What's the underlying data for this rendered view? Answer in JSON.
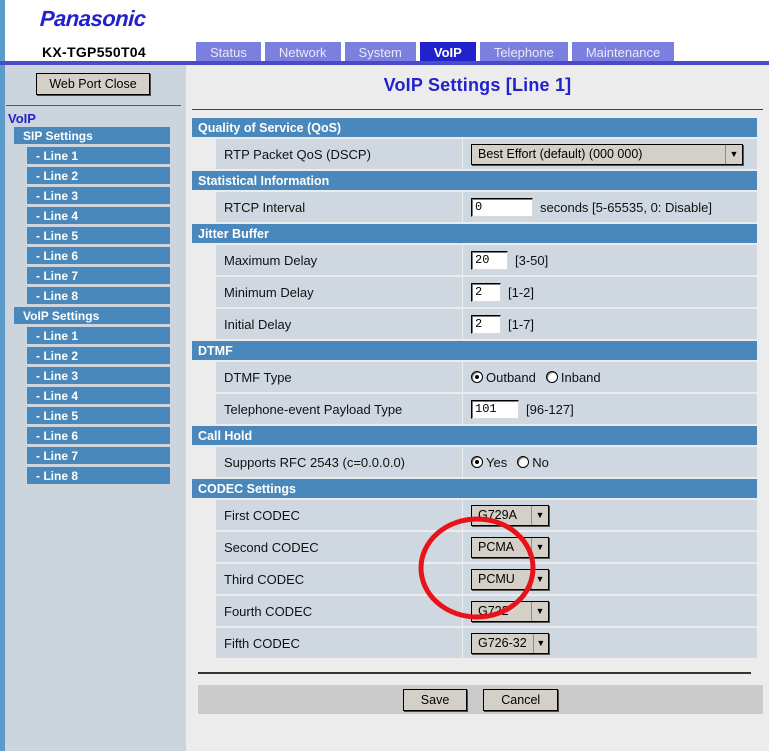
{
  "header": {
    "brand": "Panasonic",
    "model": "KX-TGP550T04"
  },
  "tabs": [
    {
      "label": "Status",
      "active": false
    },
    {
      "label": "Network",
      "active": false
    },
    {
      "label": "System",
      "active": false
    },
    {
      "label": "VoIP",
      "active": true
    },
    {
      "label": "Telephone",
      "active": false
    },
    {
      "label": "Maintenance",
      "active": false
    }
  ],
  "sidebar": {
    "web_port_close": "Web Port Close",
    "title": "VoIP",
    "groups": [
      {
        "label": "SIP Settings",
        "items": [
          "- Line 1",
          "- Line 2",
          "- Line 3",
          "- Line 4",
          "- Line 5",
          "- Line 6",
          "- Line 7",
          "- Line 8"
        ]
      },
      {
        "label": "VoIP Settings",
        "items": [
          "- Line 1",
          "- Line 2",
          "- Line 3",
          "- Line 4",
          "- Line 5",
          "- Line 6",
          "- Line 7",
          "- Line 8"
        ]
      }
    ]
  },
  "main": {
    "page_title": "VoIP Settings [Line 1]",
    "sections": {
      "qos": {
        "header": "Quality of Service (QoS)",
        "rtp_label": "RTP Packet QoS (DSCP)",
        "rtp_value": "Best Effort (default) (000 000)"
      },
      "statistical": {
        "header": "Statistical Information",
        "rtcp_label": "RTCP Interval",
        "rtcp_value": "0",
        "rtcp_hint": "seconds [5-65535, 0: Disable]"
      },
      "jitter": {
        "header": "Jitter Buffer",
        "max_label": "Maximum Delay",
        "max_value": "20",
        "max_hint": "[3-50]",
        "min_label": "Minimum Delay",
        "min_value": "2",
        "min_hint": "[1-2]",
        "init_label": "Initial Delay",
        "init_value": "2",
        "init_hint": "[1-7]"
      },
      "dtmf": {
        "header": "DTMF",
        "type_label": "DTMF Type",
        "type_options": [
          "Outband",
          "Inband"
        ],
        "type_selected": "Outband",
        "payload_label": "Telephone-event Payload Type",
        "payload_value": "101",
        "payload_hint": "[96-127]"
      },
      "callhold": {
        "header": "Call Hold",
        "rfc_label": "Supports RFC 2543 (c=0.0.0.0)",
        "rfc_options": [
          "Yes",
          "No"
        ],
        "rfc_selected": "Yes"
      },
      "codec": {
        "header": "CODEC Settings",
        "rows": [
          {
            "label": "First CODEC",
            "value": "G729A"
          },
          {
            "label": "Second CODEC",
            "value": "PCMA"
          },
          {
            "label": "Third CODEC",
            "value": "PCMU"
          },
          {
            "label": "Fourth CODEC",
            "value": "G722"
          },
          {
            "label": "Fifth CODEC",
            "value": "G726-32"
          }
        ]
      }
    },
    "footer": {
      "save": "Save",
      "cancel": "Cancel"
    }
  },
  "annotation": {
    "shape": "red-ellipse-highlight",
    "color": "#e8131a"
  },
  "colors": {
    "brand_blue": "#2222cc",
    "tab_inactive": "#7b7fdf",
    "tab_active": "#2222cc",
    "section_header": "#4a88bb",
    "row_cell": "#cfd8e1",
    "sidebar_bg": "#ccd4dd",
    "nav_item": "#4a88bb",
    "annotation_red": "#e8131a"
  }
}
